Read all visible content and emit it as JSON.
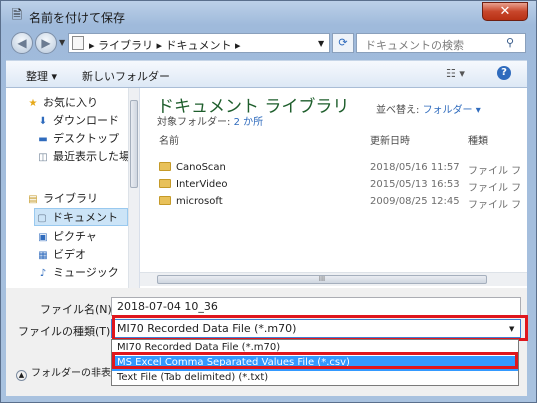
{
  "window": {
    "title": "名前を付けて保存",
    "close_label": "✕",
    "app_icon": "save-doc-icon"
  },
  "address": {
    "path": "▸ ライブラリ ▸ ドキュメント ▸",
    "search_placeholder": "ドキュメントの検索"
  },
  "toolbar": {
    "organize": "整理 ▾",
    "new_folder": "新しいフォルダー",
    "view": "☷ ▾",
    "help": "?"
  },
  "sidebar": {
    "items": [
      {
        "label": "お気に入り",
        "icon": "star-icon",
        "glyph": "★"
      },
      {
        "label": "ダウンロード",
        "icon": "download-icon",
        "glyph": "⬇"
      },
      {
        "label": "デスクトップ",
        "icon": "desktop-icon",
        "glyph": "▬"
      },
      {
        "label": "最近表示した場所",
        "icon": "recent-places-icon",
        "glyph": "◫"
      },
      {
        "label": "ライブラリ",
        "icon": "library-icon",
        "glyph": "▤"
      },
      {
        "label": "ドキュメント",
        "icon": "documents-icon",
        "glyph": "▢"
      },
      {
        "label": "ピクチャ",
        "icon": "pictures-icon",
        "glyph": "▣"
      },
      {
        "label": "ビデオ",
        "icon": "videos-icon",
        "glyph": "▦"
      },
      {
        "label": "ミュージック",
        "icon": "music-icon",
        "glyph": "♪"
      }
    ]
  },
  "main": {
    "library_title": "ドキュメント ライブラリ",
    "library_sub_prefix": "対象フォルダー: ",
    "library_sub_link": "2 か所",
    "sort_label": "並べ替え:",
    "sort_value": "フォルダー ▾",
    "columns": {
      "name": "名前",
      "date": "更新日時",
      "type": "種類"
    },
    "files": [
      {
        "name": "CanoScan",
        "date": "2018/05/16 11:57",
        "type": "ファイル フ"
      },
      {
        "name": "InterVideo",
        "date": "2015/05/13 16:53",
        "type": "ファイル フ"
      },
      {
        "name": "microsoft",
        "date": "2009/08/25 12:45",
        "type": "ファイル フ"
      }
    ],
    "hscroll_label": "III"
  },
  "form": {
    "filename_label": "ファイル名(N):",
    "filename_value": "2018-07-04 10_36",
    "type_label": "ファイルの種類(T):",
    "type_value": "MI70 Recorded Data File (*.m70)",
    "hide_folders": "フォルダーの非表",
    "type_options": [
      "MI70 Recorded Data File (*.m70)",
      "MS Excel Comma Separated Values File (*.csv)",
      "Text File (Tab delimited) (*.txt)"
    ]
  }
}
